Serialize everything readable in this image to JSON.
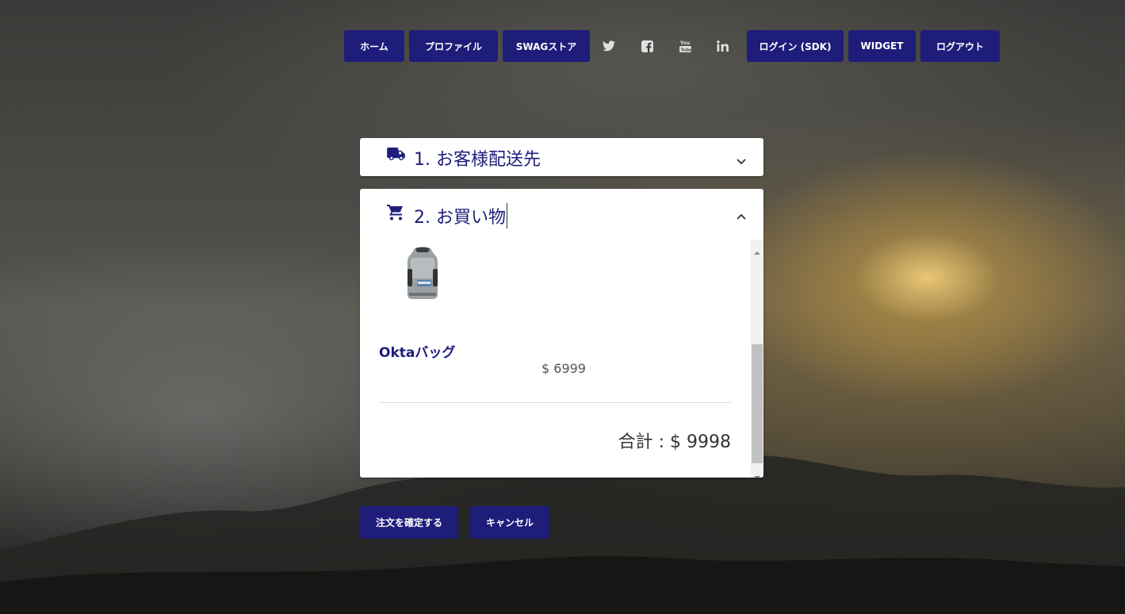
{
  "nav": {
    "home": "ホーム",
    "profile": "プロファイル",
    "swag_store": "SWAGストア",
    "login_sdk": "ログイン (SDK)",
    "widget": "WIDGET",
    "logout": "ログアウト",
    "social_icons": [
      "twitter-icon",
      "facebook-icon",
      "youtube-icon",
      "linkedin-icon"
    ]
  },
  "shipping_panel": {
    "title": "1. お客様配送先",
    "icon": "truck-icon"
  },
  "shopping_panel": {
    "title": "2. お買い物",
    "icon": "cart-icon",
    "product": {
      "name": "Oktaバッグ",
      "price": "$ 6999",
      "image": "backpack-image"
    },
    "total": "合計 : $ 9998"
  },
  "actions": {
    "confirm": "注文を確定する",
    "cancel": "キャンセル"
  },
  "colors": {
    "primary": "#1f1d7a",
    "panel_bg": "#ffffff"
  }
}
